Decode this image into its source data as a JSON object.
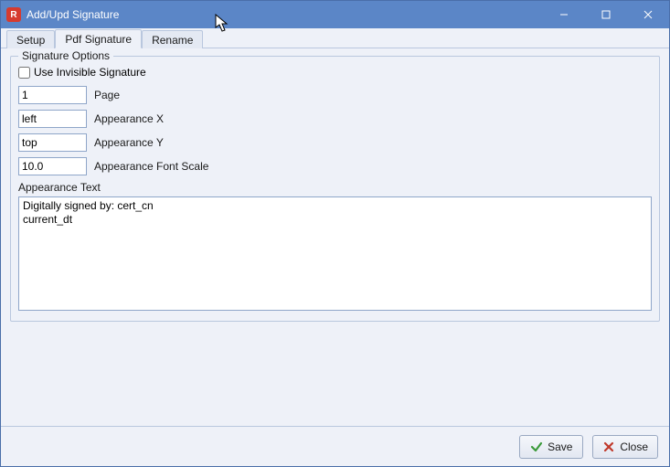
{
  "window": {
    "title": "Add/Upd Signature"
  },
  "tabs": {
    "setup": "Setup",
    "pdf_signature": "Pdf Signature",
    "rename": "Rename",
    "active": "pdf_signature"
  },
  "fieldset": {
    "legend": "Signature Options",
    "invisible_label": "Use Invisible Signature",
    "invisible_checked": false,
    "page_value": "1",
    "page_label": "Page",
    "appearance_x_value": "left",
    "appearance_x_label": "Appearance X",
    "appearance_y_value": "top",
    "appearance_y_label": "Appearance Y",
    "font_scale_value": "10.0",
    "font_scale_label": "Appearance Font Scale",
    "appearance_text_label": "Appearance Text",
    "appearance_text_value": "Digitally signed by: cert_cn\ncurrent_dt"
  },
  "buttons": {
    "save": "Save",
    "close": "Close"
  }
}
